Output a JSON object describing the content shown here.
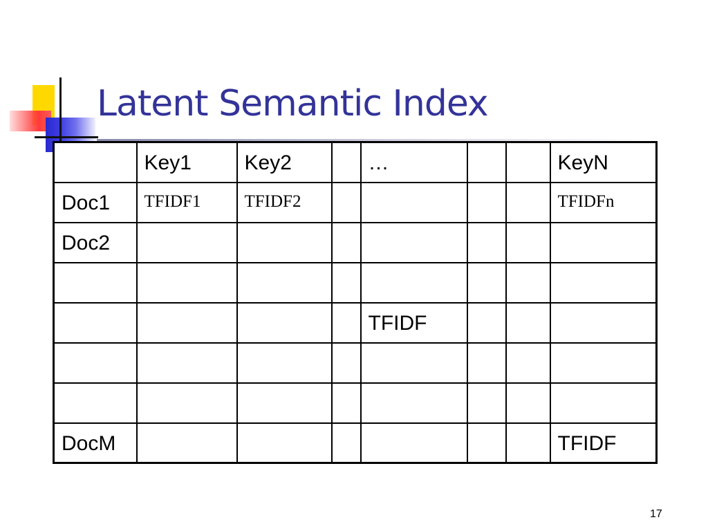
{
  "slide": {
    "title": "Latent Semantic Index",
    "page_number": "17"
  },
  "table": {
    "header": [
      "",
      "Key1",
      "Key2",
      "",
      "…",
      "",
      "",
      "KeyN"
    ],
    "rows": [
      [
        "Doc1",
        "TFIDF1",
        "TFIDF2",
        "",
        "",
        "",
        "",
        "TFIDFn"
      ],
      [
        "Doc2",
        "",
        "",
        "",
        "",
        "",
        "",
        ""
      ],
      [
        "",
        "",
        "",
        "",
        "",
        "",
        "",
        ""
      ],
      [
        "",
        "",
        "",
        "",
        "TFIDF",
        "",
        "",
        ""
      ],
      [
        "",
        "",
        "",
        "",
        "",
        "",
        "",
        ""
      ],
      [
        "",
        "",
        "",
        "",
        "",
        "",
        "",
        ""
      ],
      [
        "DocM",
        "",
        "",
        "",
        "",
        "",
        "",
        "TFIDF"
      ]
    ]
  },
  "colors": {
    "title": "#333399",
    "accent_yellow": "#ffd800",
    "accent_red": "#ff3a3a",
    "accent_blue": "#2a2ad0"
  }
}
